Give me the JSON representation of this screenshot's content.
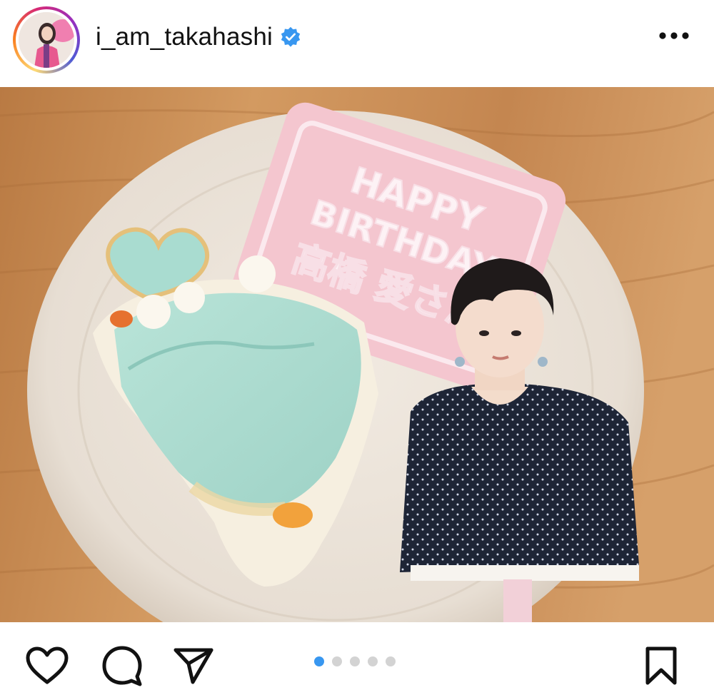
{
  "post": {
    "username": "i_am_takahashi",
    "verified": true,
    "more_icon": "more-horizontal-icon"
  },
  "photo": {
    "cookie_text_line1": "HAPPY",
    "cookie_text_line2": "BIRTHDAY",
    "cookie_text_name": "高橋 愛さん"
  },
  "carousel": {
    "total": 5,
    "active_index": 0
  },
  "actions": {
    "like_icon": "heart-icon",
    "comment_icon": "comment-icon",
    "share_icon": "paper-plane-icon",
    "save_icon": "bookmark-icon"
  },
  "colors": {
    "accent_blue": "#3897f0",
    "dot_inactive": "#d3d3d3",
    "verified_blue": "#3897f0"
  }
}
